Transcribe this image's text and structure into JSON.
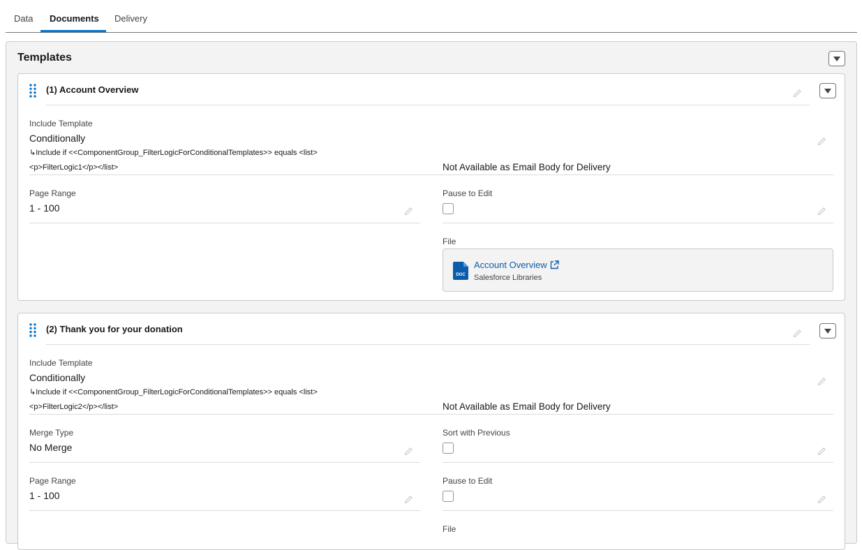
{
  "tabs": [
    {
      "label": "Data",
      "active": false
    },
    {
      "label": "Documents",
      "active": true
    },
    {
      "label": "Delivery",
      "active": false
    }
  ],
  "outer": {
    "title": "Templates"
  },
  "card1": {
    "title": "(1) Account Overview",
    "include_label": "Include Template",
    "include_value": "Conditionally",
    "condition_line1": "↳Include if <<ComponentGroup_FilterLogicForConditionalTemplates>> equals <list>",
    "condition_line2": "<p>FilterLogic1</p></list>",
    "email_body_note": "Not Available as Email Body for Delivery",
    "page_range_label": "Page Range",
    "page_range_value": "1 - 100",
    "pause_label": "Pause to Edit",
    "pause_checked": false,
    "file_label": "File",
    "file_name": "Account Overview",
    "file_source": "Salesforce Libraries",
    "doc_icon_text": "DOC"
  },
  "card2": {
    "title": "(2) Thank you for your donation",
    "include_label": "Include Template",
    "include_value": "Conditionally",
    "condition_line1": "↳Include if <<ComponentGroup_FilterLogicForConditionalTemplates>> equals <list>",
    "condition_line2": "<p>FilterLogic2</p></list>",
    "email_body_note": "Not Available as Email Body for Delivery",
    "merge_type_label": "Merge Type",
    "merge_type_value": "No Merge",
    "sort_label": "Sort with Previous",
    "sort_checked": false,
    "page_range_label": "Page Range",
    "page_range_value": "1 - 100",
    "pause_label": "Pause to Edit",
    "pause_checked": false,
    "file_label": "File"
  },
  "colors": {
    "accent": "#0176d3",
    "link": "#0b5cab",
    "doc_icon": "#0b5cab"
  }
}
